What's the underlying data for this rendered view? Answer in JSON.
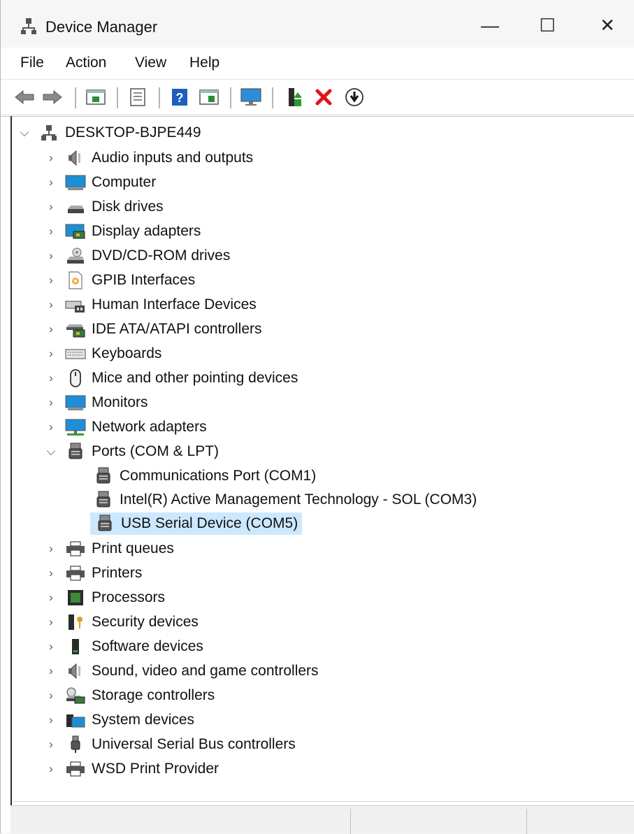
{
  "window": {
    "title": "Device Manager",
    "controls": {
      "minimize": "—",
      "maximize": "☐",
      "close": "✕"
    }
  },
  "menu": [
    "File",
    "Action",
    "View",
    "Help"
  ],
  "toolbar": {
    "buttons": [
      "back-icon",
      "forward-icon",
      "show-hide-tree-icon",
      "properties-icon",
      "help-icon",
      "action-pane-icon",
      "monitor-icon",
      "update-driver-icon",
      "uninstall-icon",
      "scan-hardware-icon"
    ]
  },
  "tree": {
    "root": "DESKTOP-BJPE449",
    "items": [
      {
        "label": "Audio inputs and outputs",
        "icon": "speaker-icon"
      },
      {
        "label": "Computer",
        "icon": "computer-icon"
      },
      {
        "label": "Disk drives",
        "icon": "disk-icon"
      },
      {
        "label": "Display adapters",
        "icon": "display-adapter-icon"
      },
      {
        "label": "DVD/CD-ROM drives",
        "icon": "dvd-icon"
      },
      {
        "label": "GPIB Interfaces",
        "icon": "gpib-icon"
      },
      {
        "label": "Human Interface Devices",
        "icon": "hid-icon"
      },
      {
        "label": "IDE ATA/ATAPI controllers",
        "icon": "ide-icon"
      },
      {
        "label": "Keyboards",
        "icon": "keyboard-icon"
      },
      {
        "label": "Mice and other pointing devices",
        "icon": "mouse-icon"
      },
      {
        "label": "Monitors",
        "icon": "monitor-icon"
      },
      {
        "label": "Network adapters",
        "icon": "network-icon"
      },
      {
        "label": "Ports (COM & LPT)",
        "icon": "port-icon",
        "expanded": true,
        "children": [
          {
            "label": "Communications Port (COM1)",
            "icon": "port-icon"
          },
          {
            "label": "Intel(R) Active Management Technology - SOL (COM3)",
            "icon": "port-icon"
          },
          {
            "label": "USB Serial Device (COM5)",
            "icon": "port-icon",
            "selected": true
          }
        ]
      },
      {
        "label": "Print queues",
        "icon": "printer-icon"
      },
      {
        "label": "Printers",
        "icon": "printer-icon"
      },
      {
        "label": "Processors",
        "icon": "processor-icon"
      },
      {
        "label": "Security devices",
        "icon": "security-icon"
      },
      {
        "label": "Software devices",
        "icon": "software-device-icon"
      },
      {
        "label": "Sound, video and game controllers",
        "icon": "speaker-icon"
      },
      {
        "label": "Storage controllers",
        "icon": "storage-icon"
      },
      {
        "label": "System devices",
        "icon": "system-folder-icon"
      },
      {
        "label": "Universal Serial Bus controllers",
        "icon": "usb-icon"
      },
      {
        "label": "WSD Print Provider",
        "icon": "printer-icon"
      }
    ]
  },
  "colors": {
    "selection": "#cce8ff",
    "accent_blue": "#1e8fd6",
    "uninstall_red": "#e0131b"
  }
}
